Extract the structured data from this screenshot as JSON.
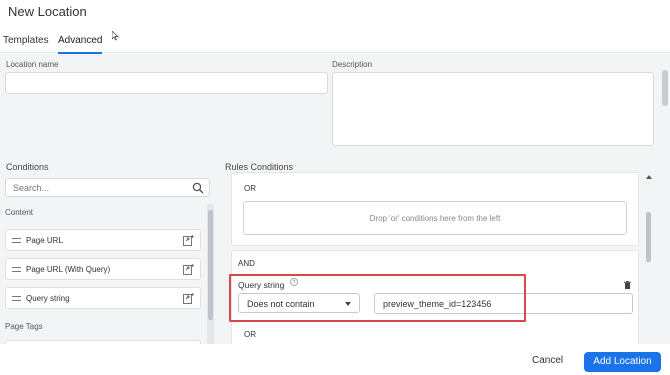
{
  "window": {
    "title": "New Location"
  },
  "tabs": [
    {
      "label": "Templates"
    },
    {
      "label": "Advanced"
    }
  ],
  "form": {
    "location_name_label": "Location name",
    "location_name_value": "",
    "description_label": "Description",
    "description_value": ""
  },
  "conditions": {
    "title": "Conditions",
    "search_placeholder": "Search...",
    "categories": [
      {
        "label": "Content",
        "items": [
          {
            "label": "Page URL"
          },
          {
            "label": "Page URL (With Query)"
          },
          {
            "label": "Query string"
          }
        ]
      },
      {
        "label": "Page Tags",
        "items": []
      }
    ]
  },
  "rules": {
    "title": "Rules Conditions",
    "group1": {
      "or_label": "OR",
      "dropzone_text": "Drop 'or' conditions here from the left"
    },
    "group2": {
      "and_label": "AND",
      "condition_label": "Query string",
      "help_icon": "question-circle-icon",
      "operator": "Does not contain",
      "value": "preview_theme_id=123456",
      "or_label": "OR"
    }
  },
  "footer": {
    "cancel_label": "Cancel",
    "add_label": "Add Location"
  },
  "colors": {
    "accent": "#1a73e8",
    "highlight": "#d24a4a",
    "content_bg": "#f3f4f6"
  }
}
